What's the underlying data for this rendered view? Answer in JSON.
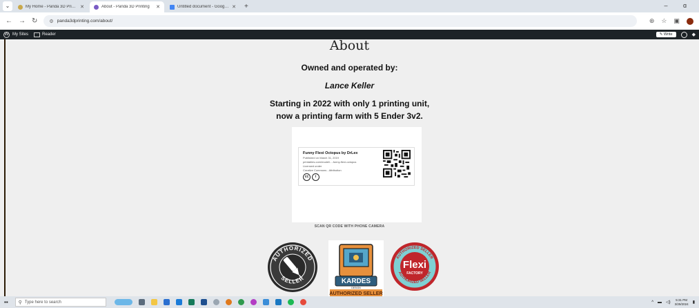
{
  "browser": {
    "tabs": [
      {
        "title": "My Home - Panda 3D Printing",
        "active": false,
        "favicon_color": "#c9a84a"
      },
      {
        "title": "About - Panda 3D Printing",
        "active": true,
        "favicon_color": "#7a5cc4"
      },
      {
        "title": "Untitled document - Google Do",
        "active": false,
        "favicon_color": "#4285f4"
      }
    ],
    "new_tab_label": "+",
    "url": "panda3dprinting.com/about/",
    "window_controls": "–  ɑ"
  },
  "wp_admin_bar": {
    "my_sites": "My Sites",
    "reader": "Reader",
    "write": "Write"
  },
  "page": {
    "heading": "About",
    "owned_label": "Owned and operated by:",
    "owner_name": "Lance Keller",
    "story_line1": "Starting in 2022 with only 1 printing unit,",
    "story_line2": "now a printing farm with 5 Ender 3v2.",
    "card": {
      "title": "Funny Flexi Octopus by DrLex",
      "published": "Published on March 31, 2019",
      "url": "printables.com/model/...-funny-flexi-octopus",
      "license1": "Licensed under",
      "license2": "Creative Commons - Attribution",
      "cc_icons": [
        "cc",
        "i"
      ]
    },
    "scan_text": "SCAN QR CODE WITH PHONE CAMERA",
    "badges": [
      {
        "name": "AUTHORIZED SELLER",
        "top": "AUTHORIZED",
        "bottom": "SELLER"
      },
      {
        "name": "KARDES",
        "sub": "DESIGN",
        "bottom": "AUTHORIZED SELLER"
      },
      {
        "name": "Flexi FACTORY",
        "word": "Flexi",
        "word2": "FACTORY",
        "ring": "AUTHORIZED SELLER"
      }
    ]
  },
  "taskbar": {
    "search_placeholder": "Type here to search",
    "time": "5:31 PM",
    "date": "3/29/2024"
  }
}
